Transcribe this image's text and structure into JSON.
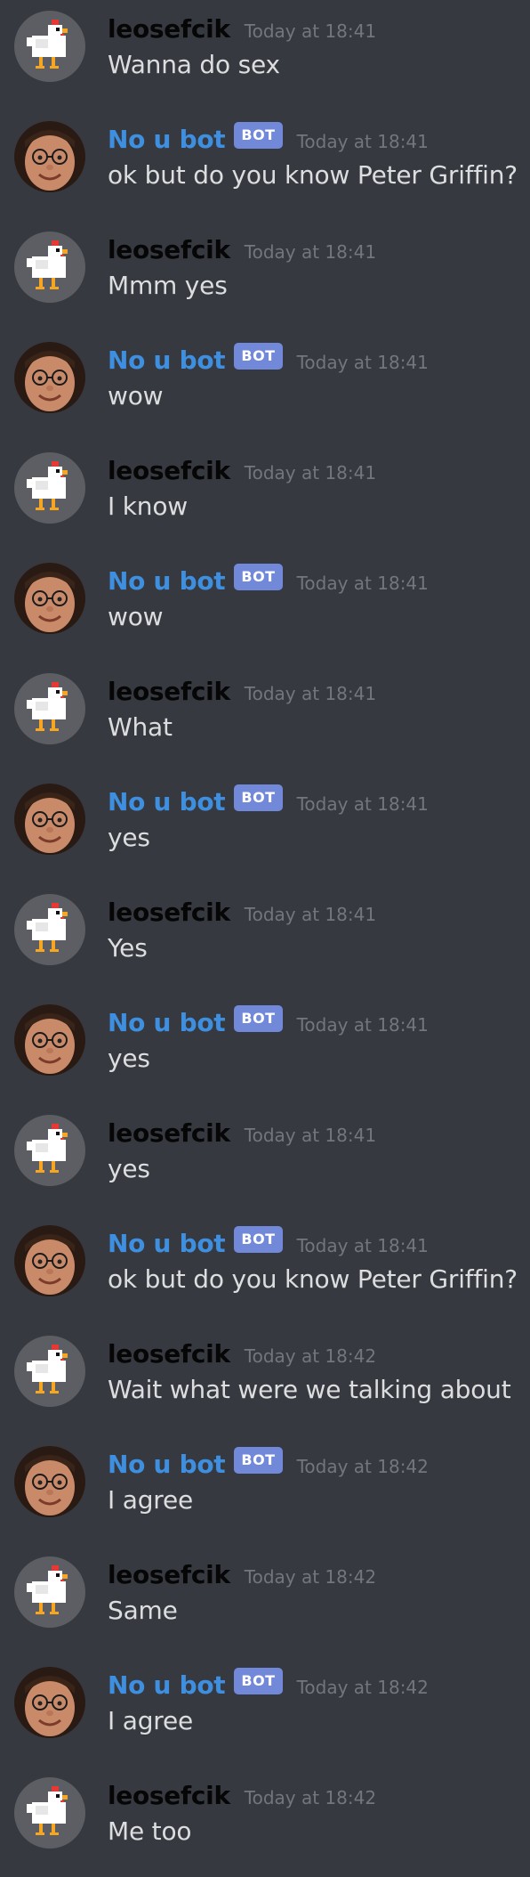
{
  "users": {
    "user": {
      "name": "leosefcik"
    },
    "bot": {
      "name": "No u bot",
      "tag": "BOT"
    }
  },
  "messages": [
    {
      "author": "user",
      "time": "Today at 18:41",
      "text": "Wanna do sex"
    },
    {
      "author": "bot",
      "time": "Today at 18:41",
      "text": "ok but do you know Peter Griffin?"
    },
    {
      "author": "user",
      "time": "Today at 18:41",
      "text": "Mmm yes"
    },
    {
      "author": "bot",
      "time": "Today at 18:41",
      "text": "wow"
    },
    {
      "author": "user",
      "time": "Today at 18:41",
      "text": "I know"
    },
    {
      "author": "bot",
      "time": "Today at 18:41",
      "text": "wow"
    },
    {
      "author": "user",
      "time": "Today at 18:41",
      "text": "What"
    },
    {
      "author": "bot",
      "time": "Today at 18:41",
      "text": "yes"
    },
    {
      "author": "user",
      "time": "Today at 18:41",
      "text": "Yes"
    },
    {
      "author": "bot",
      "time": "Today at 18:41",
      "text": "yes"
    },
    {
      "author": "user",
      "time": "Today at 18:41",
      "text": "yes"
    },
    {
      "author": "bot",
      "time": "Today at 18:41",
      "text": "ok but do you know Peter Griffin?"
    },
    {
      "author": "user",
      "time": "Today at 18:42",
      "text": "Wait what were we talking about"
    },
    {
      "author": "bot",
      "time": "Today at 18:42",
      "text": "I agree"
    },
    {
      "author": "user",
      "time": "Today at 18:42",
      "text": "Same"
    },
    {
      "author": "bot",
      "time": "Today at 18:42",
      "text": "I agree"
    },
    {
      "author": "user",
      "time": "Today at 18:42",
      "text": "Me too"
    }
  ],
  "colors": {
    "background": "#36393f",
    "user_name": "#060607",
    "bot_name": "#3f8fe0",
    "bot_tag": "#7289da",
    "timestamp": "#72767d",
    "message_text": "#dcddde"
  },
  "avatars": {
    "user": "chicken-avatar",
    "bot": "face-avatar"
  }
}
